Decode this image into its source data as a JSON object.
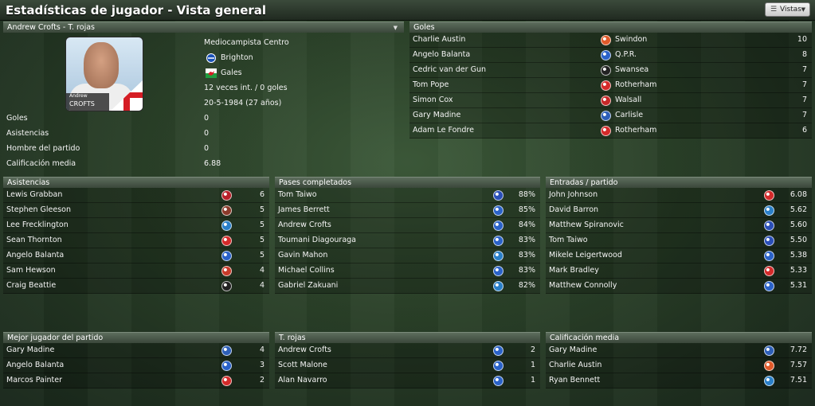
{
  "window": {
    "title": "Estadísticas de jugador - Vista general",
    "views_label": "Vistas"
  },
  "profile": {
    "header": "Andrew Crofts - T. rojas",
    "photo_first": "Andrew",
    "photo_last": "CROFTS",
    "position": "Mediocampista Centro",
    "club": "Brighton",
    "nation": "Gales",
    "caps": "12 veces int. / 0 goles",
    "born": "20-5-1984 (27 años)",
    "stats": [
      {
        "label": "Goles",
        "value": "0"
      },
      {
        "label": "Asistencias",
        "value": "0"
      },
      {
        "label": "Hombre del partido",
        "value": "0"
      },
      {
        "label": "Calificación media",
        "value": "6.88"
      }
    ]
  },
  "goals": {
    "title": "Goles",
    "rows": [
      {
        "name": "Charlie Austin",
        "club": "Swindon",
        "value": "10",
        "color": "#e05a2a"
      },
      {
        "name": "Angelo Balanta",
        "club": "Q.P.R.",
        "value": "8",
        "color": "#2a62c8"
      },
      {
        "name": "Cedric van der Gun",
        "club": "Swansea",
        "value": "7",
        "color": "#222222"
      },
      {
        "name": "Tom Pope",
        "club": "Rotherham",
        "value": "7",
        "color": "#d42a2a"
      },
      {
        "name": "Simon Cox",
        "club": "Walsall",
        "value": "7",
        "color": "#c62828"
      },
      {
        "name": "Gary Madine",
        "club": "Carlisle",
        "value": "7",
        "color": "#2d5fb8"
      },
      {
        "name": "Adam Le Fondre",
        "club": "Rotherham",
        "value": "6",
        "color": "#d42a2a"
      }
    ]
  },
  "assists": {
    "title": "Asistencias",
    "rows": [
      {
        "name": "Lewis Grabban",
        "value": "6",
        "color": "#b8202a"
      },
      {
        "name": "Stephen Gleeson",
        "value": "5",
        "color": "#8b3a2a"
      },
      {
        "name": "Lee Frecklington",
        "value": "5",
        "color": "#2a7fc8"
      },
      {
        "name": "Sean Thornton",
        "value": "5",
        "color": "#d42a2a"
      },
      {
        "name": "Angelo Balanta",
        "value": "5",
        "color": "#2a62c8"
      },
      {
        "name": "Sam Hewson",
        "value": "4",
        "color": "#c83a2a"
      },
      {
        "name": "Craig Beattie",
        "value": "4",
        "color": "#222222"
      }
    ]
  },
  "passes": {
    "title": "Pases completados",
    "rows": [
      {
        "name": "Tom Taiwo",
        "value": "88%",
        "color": "#2a4fb8"
      },
      {
        "name": "James Berrett",
        "value": "85%",
        "color": "#2a62c8"
      },
      {
        "name": "Andrew Crofts",
        "value": "84%",
        "color": "#2a62c8"
      },
      {
        "name": "Toumani Diagouraga",
        "value": "83%",
        "color": "#2a62c8"
      },
      {
        "name": "Gavin Mahon",
        "value": "83%",
        "color": "#2a7fc8"
      },
      {
        "name": "Michael Collins",
        "value": "83%",
        "color": "#2a62c8"
      },
      {
        "name": "Gabriel Zakuani",
        "value": "82%",
        "color": "#2a7fc8"
      }
    ]
  },
  "tackles": {
    "title": "Entradas / partido",
    "rows": [
      {
        "name": "John Johnson",
        "value": "6.08",
        "color": "#d42a2a"
      },
      {
        "name": "David Barron",
        "value": "5.62",
        "color": "#2a7fc8"
      },
      {
        "name": "Matthew Spiranovic",
        "value": "5.60",
        "color": "#2a4fb8"
      },
      {
        "name": "Tom Taiwo",
        "value": "5.50",
        "color": "#2a4fb8"
      },
      {
        "name": "Mikele Leigertwood",
        "value": "5.38",
        "color": "#2a62c8"
      },
      {
        "name": "Mark Bradley",
        "value": "5.33",
        "color": "#d42a2a"
      },
      {
        "name": "Matthew Connolly",
        "value": "5.31",
        "color": "#2a62c8"
      }
    ]
  },
  "motm": {
    "title": "Mejor jugador del partido",
    "rows": [
      {
        "name": "Gary Madine",
        "value": "4",
        "color": "#2d5fb8"
      },
      {
        "name": "Angelo Balanta",
        "value": "3",
        "color": "#2a62c8"
      },
      {
        "name": "Marcos Painter",
        "value": "2",
        "color": "#d42a2a"
      }
    ]
  },
  "reds": {
    "title": "T. rojas",
    "rows": [
      {
        "name": "Andrew Crofts",
        "value": "2",
        "color": "#2a62c8"
      },
      {
        "name": "Scott Malone",
        "value": "1",
        "color": "#2a62c8"
      },
      {
        "name": "Alan Navarro",
        "value": "1",
        "color": "#2a62c8"
      }
    ]
  },
  "rating": {
    "title": "Calificación media",
    "rows": [
      {
        "name": "Gary Madine",
        "value": "7.72",
        "color": "#2d5fb8"
      },
      {
        "name": "Charlie Austin",
        "value": "7.57",
        "color": "#e05a2a"
      },
      {
        "name": "Ryan Bennett",
        "value": "7.51",
        "color": "#2a7fc8"
      }
    ]
  }
}
